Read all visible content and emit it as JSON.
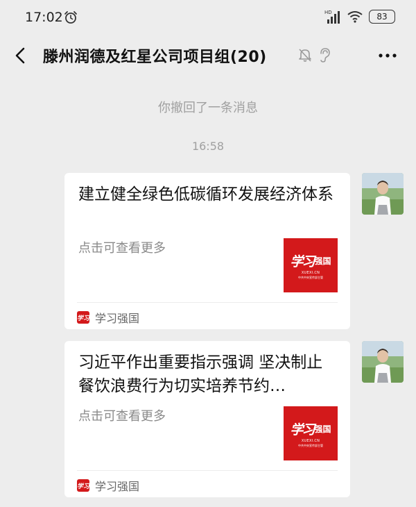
{
  "status_bar": {
    "time": "17:02",
    "network_label": "HD",
    "battery": "83"
  },
  "header": {
    "title": "滕州润德及红星公司项目组(20)"
  },
  "system": {
    "recall_notice": "你撤回了一条消息",
    "timestamp": "16:58"
  },
  "messages": [
    {
      "title": "建立健全绿色低碳循环发展经济体系",
      "desc": "点击可查看更多",
      "thumb_calligraphy": "学习",
      "thumb_brand": "强国",
      "thumb_url": "XUEXI.CN",
      "thumb_slogan": "中共中央宣传部主管",
      "source_logo": "学习",
      "source": "学习强国"
    },
    {
      "title": "习近平作出重要指示强调 坚决制止餐饮浪费行为切实培养节约…",
      "desc": "点击可查看更多",
      "thumb_calligraphy": "学习",
      "thumb_brand": "强国",
      "thumb_url": "XUEXI.CN",
      "thumb_slogan": "中共中央宣传部主管",
      "source_logo": "学习",
      "source": "学习强国"
    }
  ],
  "colors": {
    "background": "#ededed",
    "brand_red": "#d3191b",
    "muted_text": "#a0a0a0"
  },
  "icons": [
    "alarm-icon",
    "signal-icon",
    "wifi-icon",
    "back-icon",
    "mute-icon",
    "ear-icon",
    "more-icon"
  ]
}
